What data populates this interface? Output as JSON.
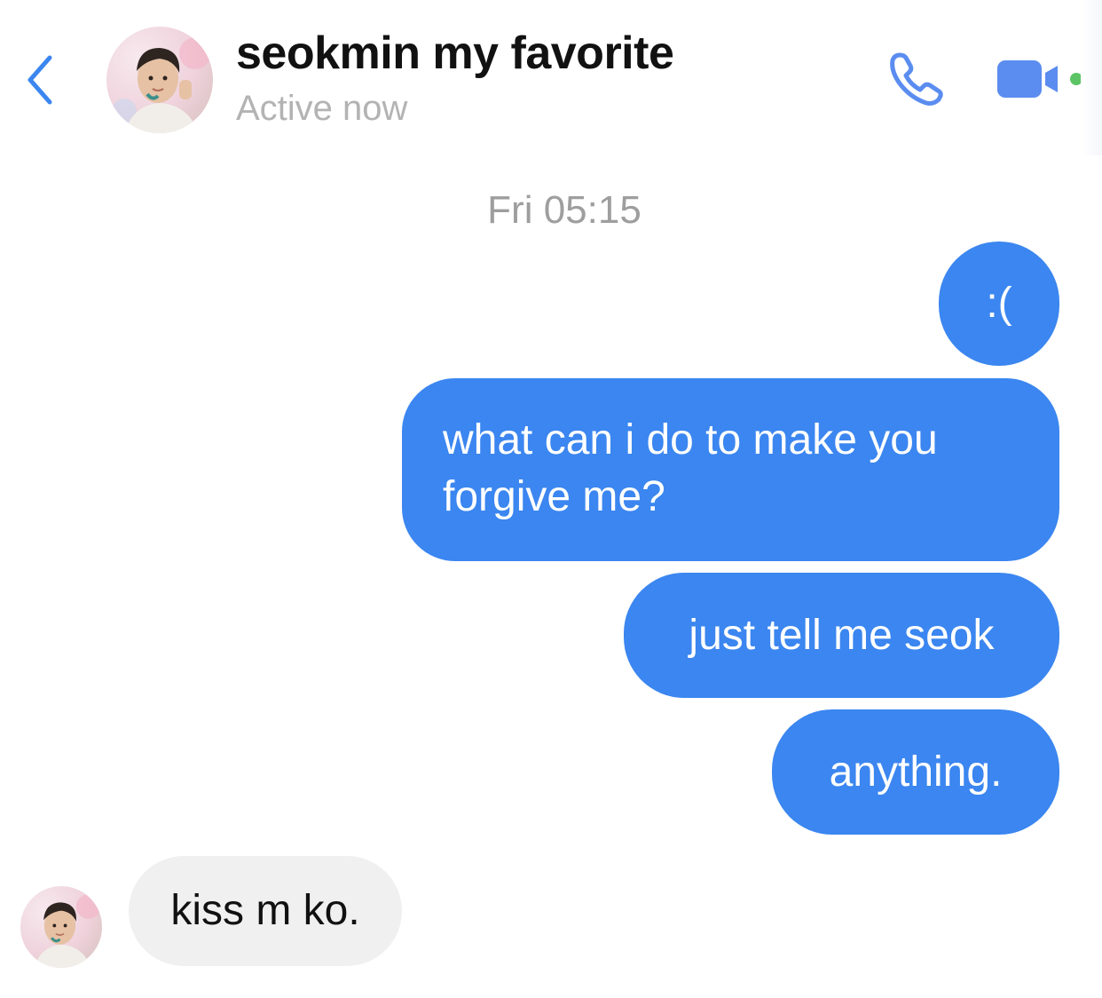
{
  "header": {
    "contact_name": "seokmin my favorite",
    "status": "Active now",
    "back_icon": "chevron-left-icon",
    "call_icon": "phone-icon",
    "video_icon": "video-camera-icon",
    "online_indicator_color": "#5cc465"
  },
  "conversation": {
    "timestamp": "Fri 05:15",
    "messages": [
      {
        "direction": "outgoing",
        "text": ":("
      },
      {
        "direction": "outgoing",
        "text": "what can i do to make you forgive me?"
      },
      {
        "direction": "outgoing",
        "text": "just tell me seok"
      },
      {
        "direction": "outgoing",
        "text": "anything."
      },
      {
        "direction": "incoming",
        "text": "kiss m ko."
      }
    ]
  },
  "colors": {
    "accent": "#3b86f0",
    "outgoing_bubble": "#3b86f0",
    "incoming_bubble": "#f0f0f0",
    "icon_blue": "#5b8df0"
  }
}
